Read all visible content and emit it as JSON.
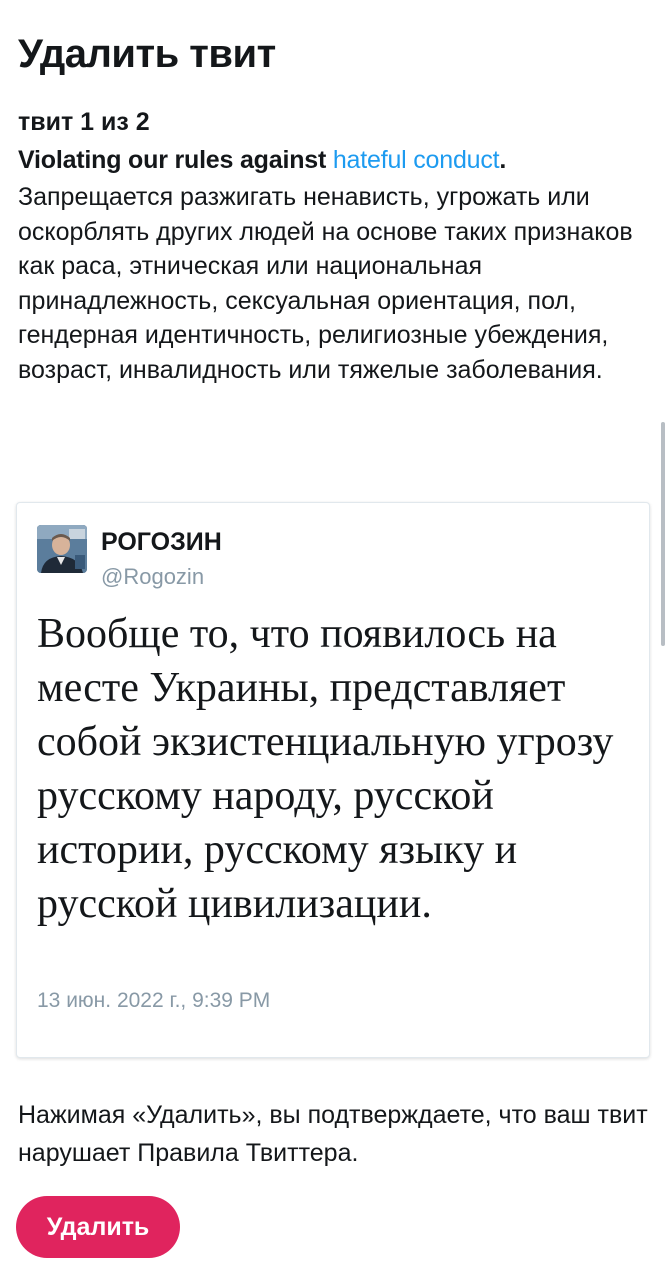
{
  "header": {
    "title": "Удалить твит"
  },
  "counter": "твит 1 из 2",
  "rule": {
    "prefix": "Violating our rules against ",
    "link": "hateful conduct",
    "suffix": ".",
    "body": "Запрещается разжигать ненависть, угрожать или оскорблять других людей на основе таких признаков как раса, этническая или национальная принадлежность, сексуальная ориентация, пол, гендерная идентичность, религиозные убеждения, возраст, инвалидность или тяжелые заболевания."
  },
  "tweet": {
    "author_name": "РОГОЗИН",
    "author_handle": "@Rogozin",
    "text": "Вообще то, что появилось на месте Украины, представляет собой экзистенциальную угрозу русскому народу, русской истории, русскому языку и русской цивилизации.",
    "date": "13 июн. 2022 г., 9:39 PM"
  },
  "disclaimer": "Нажимая «Удалить», вы подтверждаете, что ваш твит нарушает Правила Твиттера.",
  "delete_button": {
    "label": "Удалить"
  },
  "colors": {
    "link": "#1d9bf0",
    "delete_button": "#e0245e",
    "secondary_text": "#8899a6",
    "primary_text": "#14171a"
  }
}
